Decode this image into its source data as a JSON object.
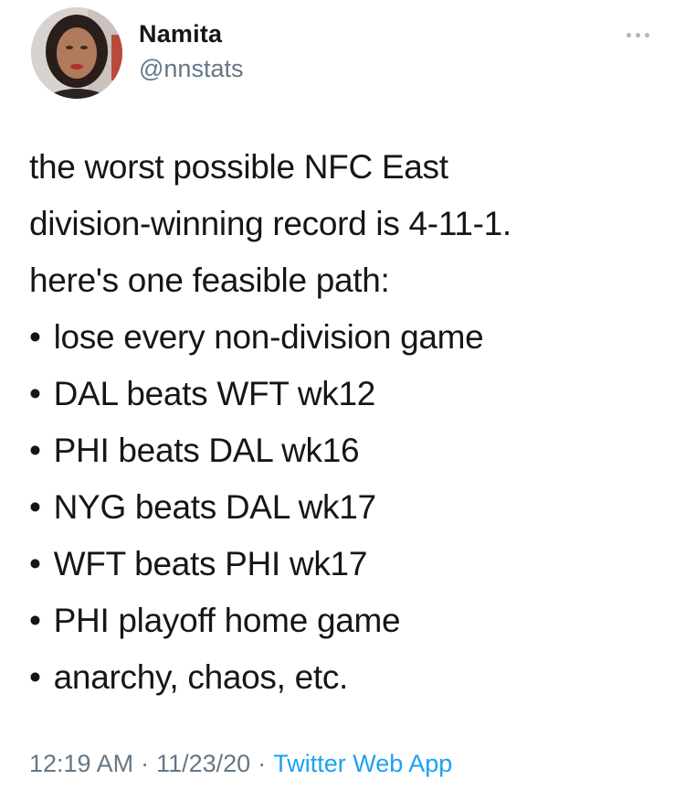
{
  "author": {
    "name": "Namita",
    "handle": "@nnstats"
  },
  "tweet": {
    "intro_lines": [
      "the worst possible NFC East",
      "division-winning record is 4-11-1.",
      "here's one feasible path:"
    ],
    "bullet_char": "•",
    "bullets": [
      "lose every non-division game",
      "DAL beats WFT wk12",
      "PHI beats DAL wk16",
      "NYG beats DAL wk17",
      "WFT beats PHI wk17",
      "PHI playoff home game",
      "anarchy, chaos, etc."
    ]
  },
  "meta": {
    "time": "12:19 AM",
    "separator": "·",
    "date": "11/23/20",
    "source": "Twitter Web App"
  },
  "colors": {
    "text": "#14171a",
    "secondary": "#657786",
    "link": "#1da1f2"
  },
  "icons": {
    "more": "more-horizontal-icon"
  }
}
